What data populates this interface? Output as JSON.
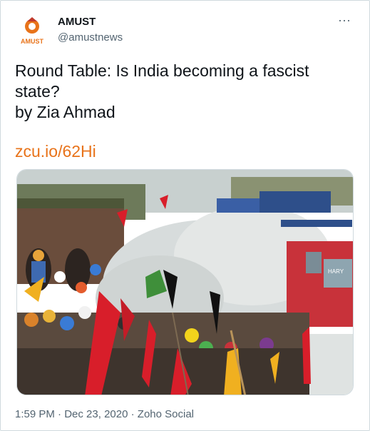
{
  "account": {
    "display_name": "AMUST",
    "handle": "@amustnews",
    "logo_text": "AMUST",
    "brand_color": "#e8731a"
  },
  "menu": {
    "more_icon": "more-dots-icon",
    "more_label": "···"
  },
  "tweet": {
    "text": "Round Table: Is India becoming a fascist\nstate?\nby Zia Ahmad",
    "link_text": "zcu.io/62Hi",
    "link_color": "#e8731a"
  },
  "media": {
    "description_icon": "protest-photo"
  },
  "footer": {
    "time": "1:59 PM",
    "separator_1": " · ",
    "date": "Dec 23, 2020",
    "separator_2": " · ",
    "source": "Zoho Social"
  }
}
